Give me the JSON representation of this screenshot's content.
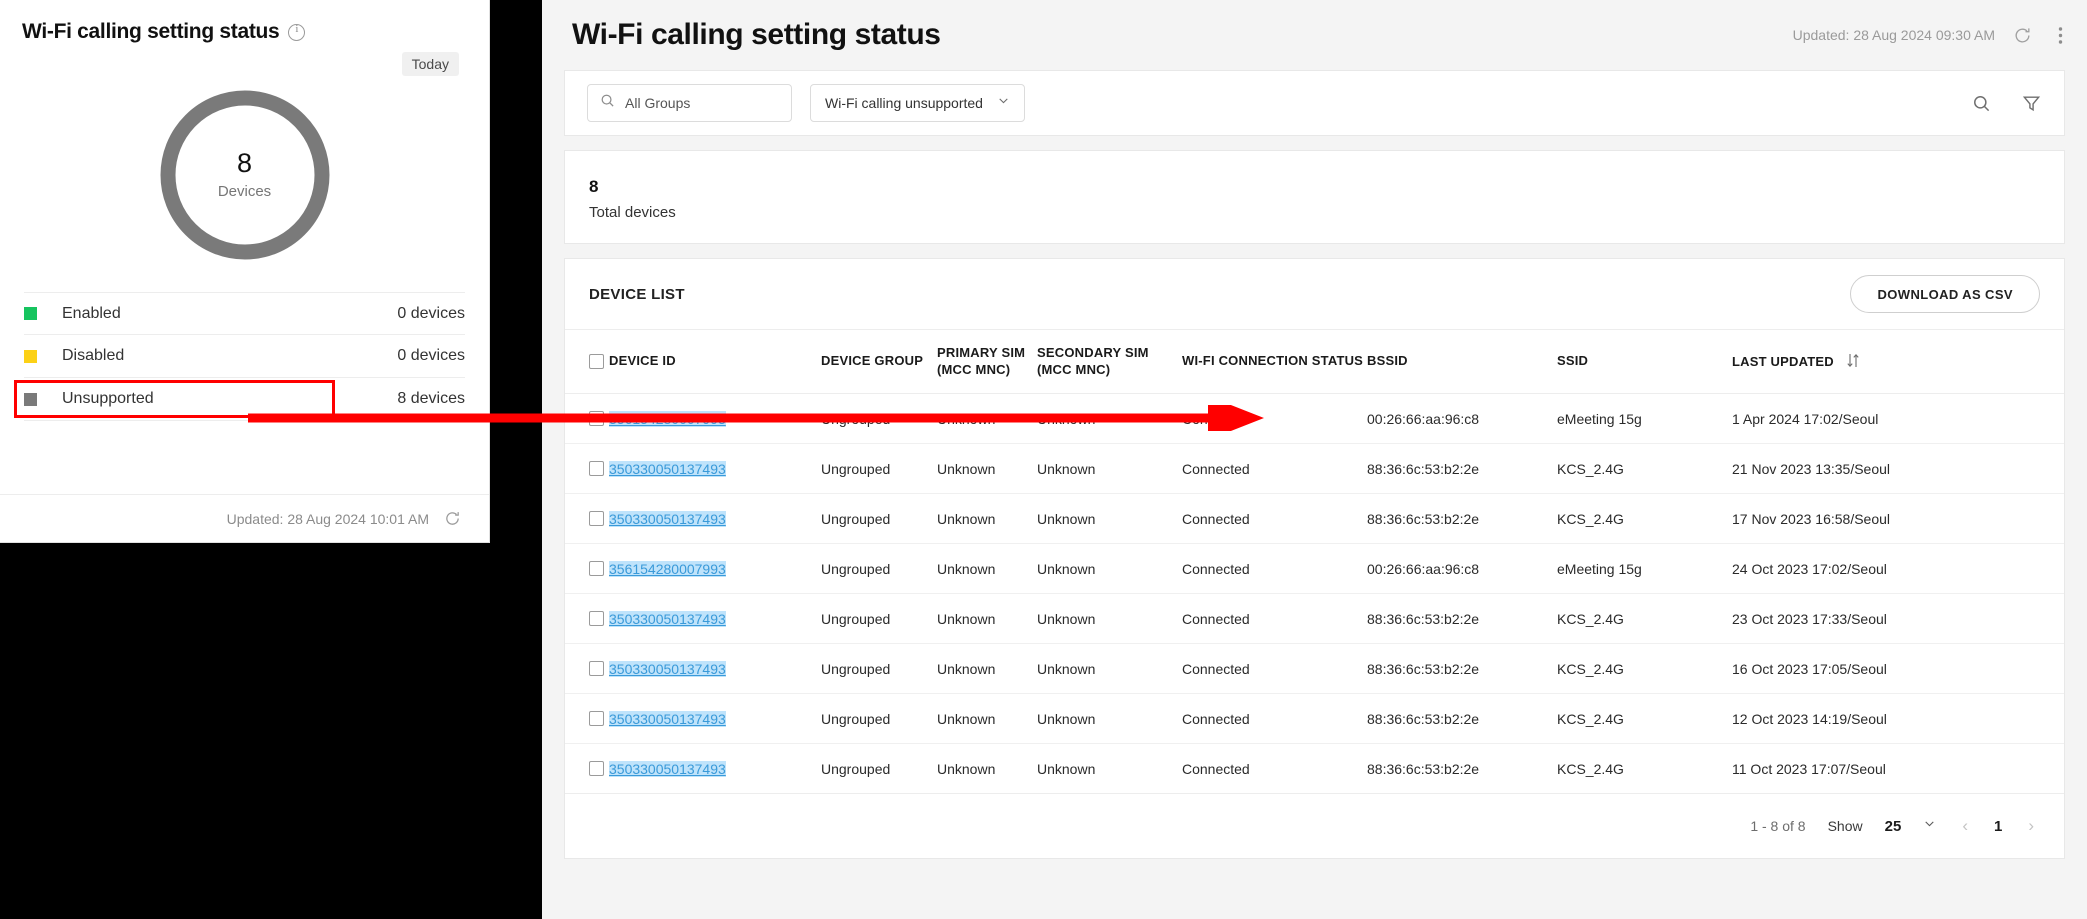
{
  "left_card": {
    "title": "Wi-Fi calling setting status",
    "info_icon": "info-icon",
    "period_chip": "Today",
    "donut": {
      "value": "8",
      "label": "Devices"
    },
    "legend": [
      {
        "name": "Enabled",
        "count": "0 devices",
        "color": "#16c45f"
      },
      {
        "name": "Disabled",
        "count": "0 devices",
        "color": "#fcd116"
      },
      {
        "name": "Unsupported",
        "count": "8 devices",
        "color": "#7a7a7a"
      }
    ],
    "footer_updated": "Updated: 28 Aug 2024 10:01 AM",
    "refresh_icon": "refresh-icon"
  },
  "main": {
    "title": "Wi-Fi calling setting status",
    "updated": "Updated: 28 Aug 2024 09:30 AM",
    "refresh_icon": "refresh-icon",
    "more_icon": "more-vertical-icon",
    "filters": {
      "group_search_icon": "search-icon",
      "group_search_value": "All Groups",
      "status_dropdown_value": "Wi-Fi calling unsupported",
      "chevron_icon": "chevron-down-icon",
      "search_icon": "search-icon",
      "filter_icon": "filter-icon"
    },
    "summary": {
      "total_value": "8",
      "total_label": "Total devices"
    },
    "list": {
      "heading": "DEVICE LIST",
      "download_label": "DOWNLOAD AS CSV",
      "columns": [
        "DEVICE ID",
        "DEVICE GROUP",
        "PRIMARY SIM\n(MCC MNC)",
        "SECONDARY SIM\n(MCC MNC)",
        "WI-FI CONNECTION STATUS",
        "BSSID",
        "SSID",
        "LAST UPDATED"
      ],
      "columns_split": {
        "device_id": "DEVICE ID",
        "device_group": "DEVICE GROUP",
        "primary_sim_l1": "PRIMARY SIM",
        "primary_sim_l2": "(MCC MNC)",
        "secondary_sim_l1": "SECONDARY SIM",
        "secondary_sim_l2": "(MCC MNC)",
        "wifi_status": "WI-FI CONNECTION STATUS",
        "bssid": "BSSID",
        "ssid": "SSID",
        "last_updated": "LAST UPDATED"
      },
      "sort_icon": "sort-icon",
      "rows": [
        {
          "device_id": "356154280007993",
          "device_group": "Ungrouped",
          "primary_sim": "Unknown",
          "secondary_sim": "Unknown",
          "wifi_status": "Connected",
          "bssid": "00:26:66:aa:96:c8",
          "ssid": "eMeeting 15g",
          "last_updated": "1 Apr 2024 17:02/Seoul"
        },
        {
          "device_id": "350330050137493",
          "device_group": "Ungrouped",
          "primary_sim": "Unknown",
          "secondary_sim": "Unknown",
          "wifi_status": "Connected",
          "bssid": "88:36:6c:53:b2:2e",
          "ssid": "KCS_2.4G",
          "last_updated": "21 Nov 2023 13:35/Seoul"
        },
        {
          "device_id": "350330050137493",
          "device_group": "Ungrouped",
          "primary_sim": "Unknown",
          "secondary_sim": "Unknown",
          "wifi_status": "Connected",
          "bssid": "88:36:6c:53:b2:2e",
          "ssid": "KCS_2.4G",
          "last_updated": "17 Nov 2023 16:58/Seoul"
        },
        {
          "device_id": "356154280007993",
          "device_group": "Ungrouped",
          "primary_sim": "Unknown",
          "secondary_sim": "Unknown",
          "wifi_status": "Connected",
          "bssid": "00:26:66:aa:96:c8",
          "ssid": "eMeeting 15g",
          "last_updated": "24 Oct 2023 17:02/Seoul"
        },
        {
          "device_id": "350330050137493",
          "device_group": "Ungrouped",
          "primary_sim": "Unknown",
          "secondary_sim": "Unknown",
          "wifi_status": "Connected",
          "bssid": "88:36:6c:53:b2:2e",
          "ssid": "KCS_2.4G",
          "last_updated": "23 Oct 2023 17:33/Seoul"
        },
        {
          "device_id": "350330050137493",
          "device_group": "Ungrouped",
          "primary_sim": "Unknown",
          "secondary_sim": "Unknown",
          "wifi_status": "Connected",
          "bssid": "88:36:6c:53:b2:2e",
          "ssid": "KCS_2.4G",
          "last_updated": "16 Oct 2023 17:05/Seoul"
        },
        {
          "device_id": "350330050137493",
          "device_group": "Ungrouped",
          "primary_sim": "Unknown",
          "secondary_sim": "Unknown",
          "wifi_status": "Connected",
          "bssid": "88:36:6c:53:b2:2e",
          "ssid": "KCS_2.4G",
          "last_updated": "12 Oct 2023 14:19/Seoul"
        },
        {
          "device_id": "350330050137493",
          "device_group": "Ungrouped",
          "primary_sim": "Unknown",
          "secondary_sim": "Unknown",
          "wifi_status": "Connected",
          "bssid": "88:36:6c:53:b2:2e",
          "ssid": "KCS_2.4G",
          "last_updated": "11 Oct 2023 17:07/Seoul"
        }
      ],
      "pagination": {
        "range": "1 - 8 of 8",
        "show_label": "Show",
        "page_size": "25",
        "chevron_icon": "chevron-down-icon",
        "prev_icon": "chevron-left-icon",
        "current_page": "1",
        "next_icon": "chevron-right-icon"
      }
    }
  },
  "annotation": {
    "arrow_color": "#ff0000",
    "highlight_target": "Unsupported"
  },
  "chart_data": {
    "type": "pie",
    "title": "Wi-Fi calling setting status",
    "categories": [
      "Enabled",
      "Disabled",
      "Unsupported"
    ],
    "values": [
      0,
      0,
      8
    ],
    "colors": [
      "#16c45f",
      "#fcd116",
      "#7a7a7a"
    ],
    "center_value": 8,
    "center_label": "Devices",
    "legend": "bottom",
    "total": 8
  }
}
